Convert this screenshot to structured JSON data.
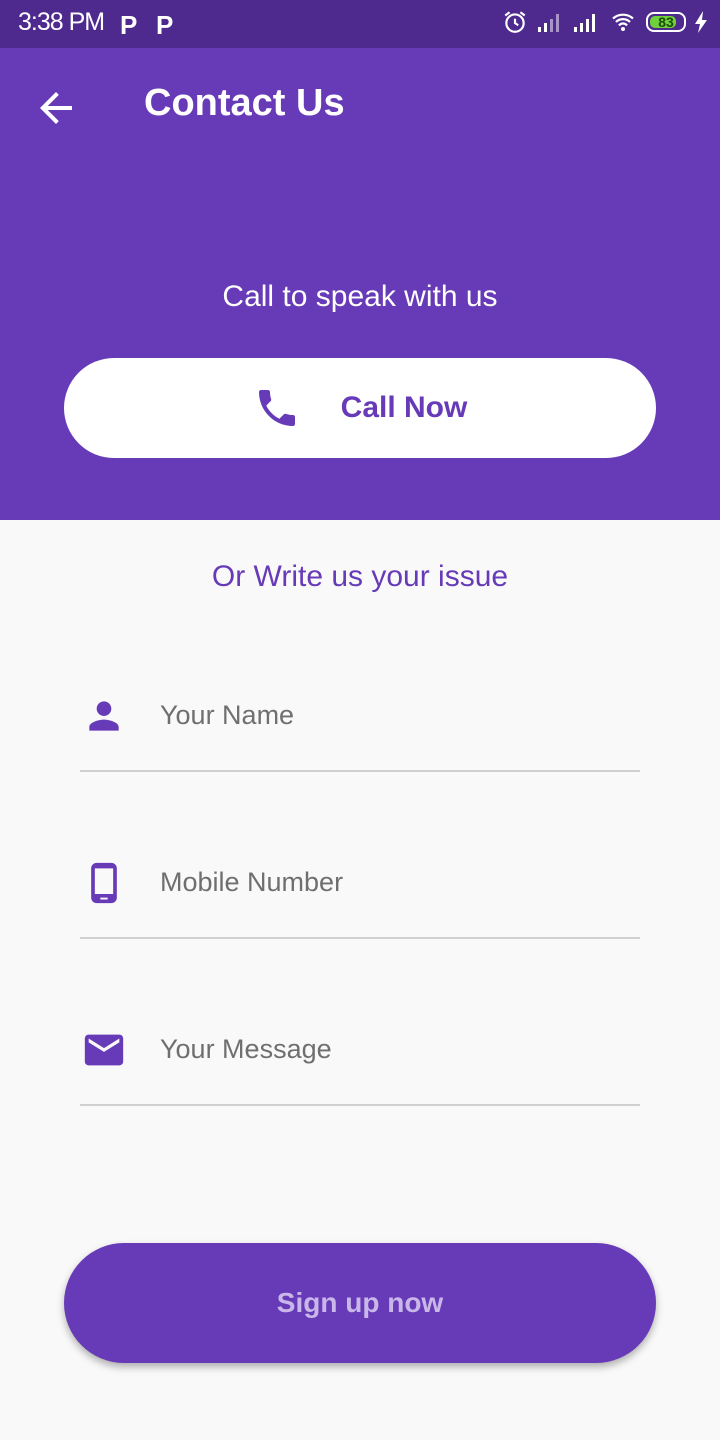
{
  "status_bar": {
    "time": "3:38 PM",
    "notification_icons": [
      "P",
      "P"
    ],
    "battery_level": "83"
  },
  "header": {
    "title": "Contact Us",
    "back_icon": "arrow-back-icon",
    "call_caption": "Call to speak with us",
    "call_button_label": "Call Now",
    "call_icon": "phone-icon"
  },
  "form": {
    "subheading": "Or Write us your issue",
    "fields": [
      {
        "placeholder": "Your Name",
        "icon": "person-icon"
      },
      {
        "placeholder": "Mobile Number",
        "icon": "mobile-phone-icon"
      },
      {
        "placeholder": "Your Message",
        "icon": "mail-icon"
      }
    ],
    "submit_label": "Sign up now"
  },
  "colors": {
    "primary": "#673ab7",
    "status_bar": "#4e2a8e",
    "background": "#f9f9f9",
    "placeholder_text": "#6f6f6f",
    "battery": "#6fd13a"
  }
}
